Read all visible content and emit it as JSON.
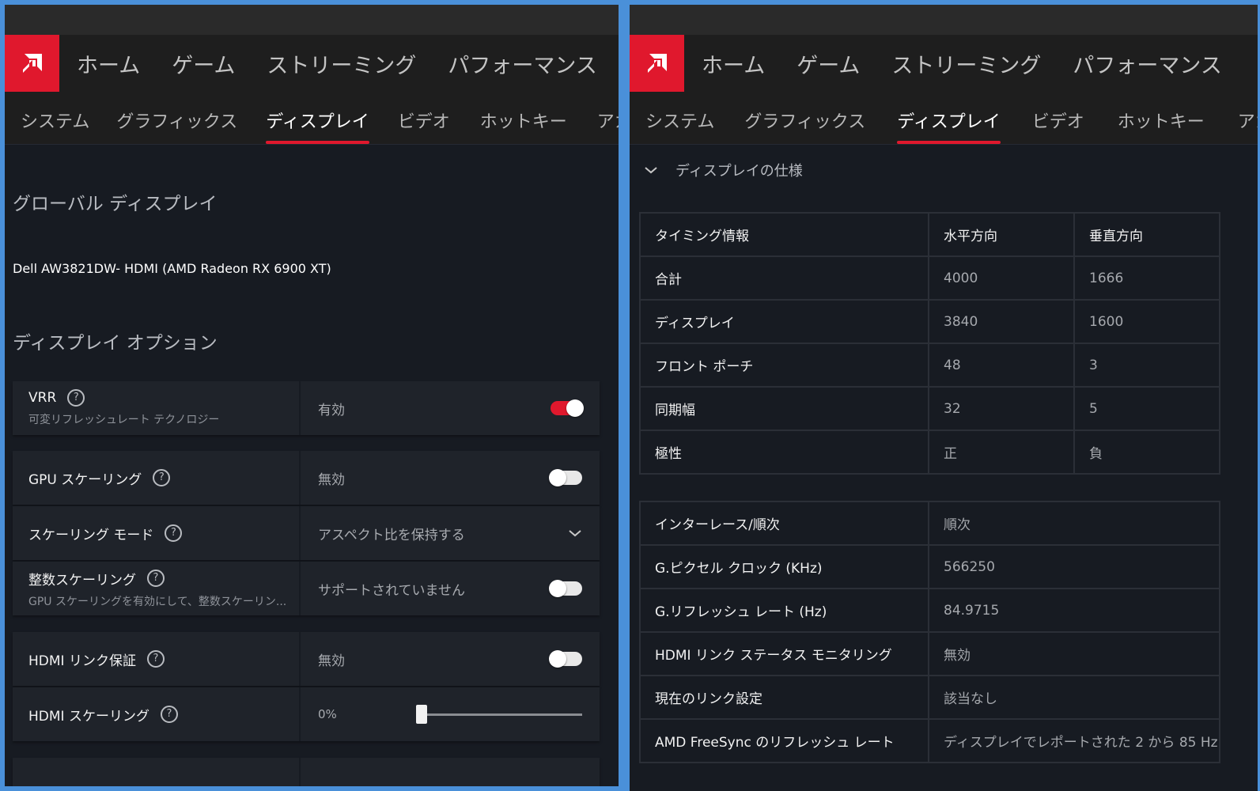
{
  "colors": {
    "accent": "#e0182d",
    "background": "#171b22",
    "nav_bg": "#1e1e1e"
  },
  "nav": {
    "main": [
      "ホーム",
      "ゲーム",
      "ストリーミング",
      "パフォーマンス"
    ],
    "tabs": [
      "システム",
      "グラフィックス",
      "ディスプレイ",
      "ビデオ",
      "ホットキー",
      "アカウント"
    ],
    "active_tab": "ディスプレイ"
  },
  "left": {
    "global_title": "グローバル ディスプレイ",
    "device": "Dell AW3821DW- HDMI (AMD Radeon RX 6900 XT)",
    "options_title": "ディスプレイ オプション",
    "vrr": {
      "label": "VRR",
      "sub": "可変リフレッシュレート テクノロジー",
      "value": "有効",
      "enabled": true
    },
    "gpu_scaling": {
      "label": "GPU スケーリング",
      "value": "無効",
      "enabled": false
    },
    "scaling_mode": {
      "label": "スケーリング モード",
      "value": "アスペクト比を保持する"
    },
    "integer_scaling": {
      "label": "整数スケーリング",
      "sub": "GPU スケーリングを有効にして、整数スケーリン...",
      "value": "サポートされていません",
      "enabled": false
    },
    "hdmi_link": {
      "label": "HDMI リンク保証",
      "value": "無効",
      "enabled": false
    },
    "hdmi_scaling": {
      "label": "HDMI スケーリング",
      "value": "0%",
      "level_percent": 0
    }
  },
  "right": {
    "spec_title": "ディスプレイの仕様",
    "timing": {
      "headers": [
        "タイミング情報",
        "水平方向",
        "垂直方向"
      ],
      "rows": [
        [
          "合計",
          "4000",
          "1666"
        ],
        [
          "ディスプレイ",
          "3840",
          "1600"
        ],
        [
          "フロント ポーチ",
          "48",
          "3"
        ],
        [
          "同期幅",
          "32",
          "5"
        ],
        [
          "極性",
          "正",
          "負"
        ]
      ]
    },
    "info": [
      [
        "インターレース/順次",
        "順次"
      ],
      [
        "G.ピクセル クロック (KHz)",
        "566250"
      ],
      [
        "G.リフレッシュ レート (Hz)",
        "84.9715"
      ],
      [
        "HDMI リンク ステータス モニタリング",
        "無効"
      ],
      [
        "現在のリンク設定",
        "該当なし"
      ],
      [
        "AMD FreeSync のリフレッシュ レート",
        "ディスプレイでレポートされた 2 から 85 Hz"
      ]
    ]
  }
}
